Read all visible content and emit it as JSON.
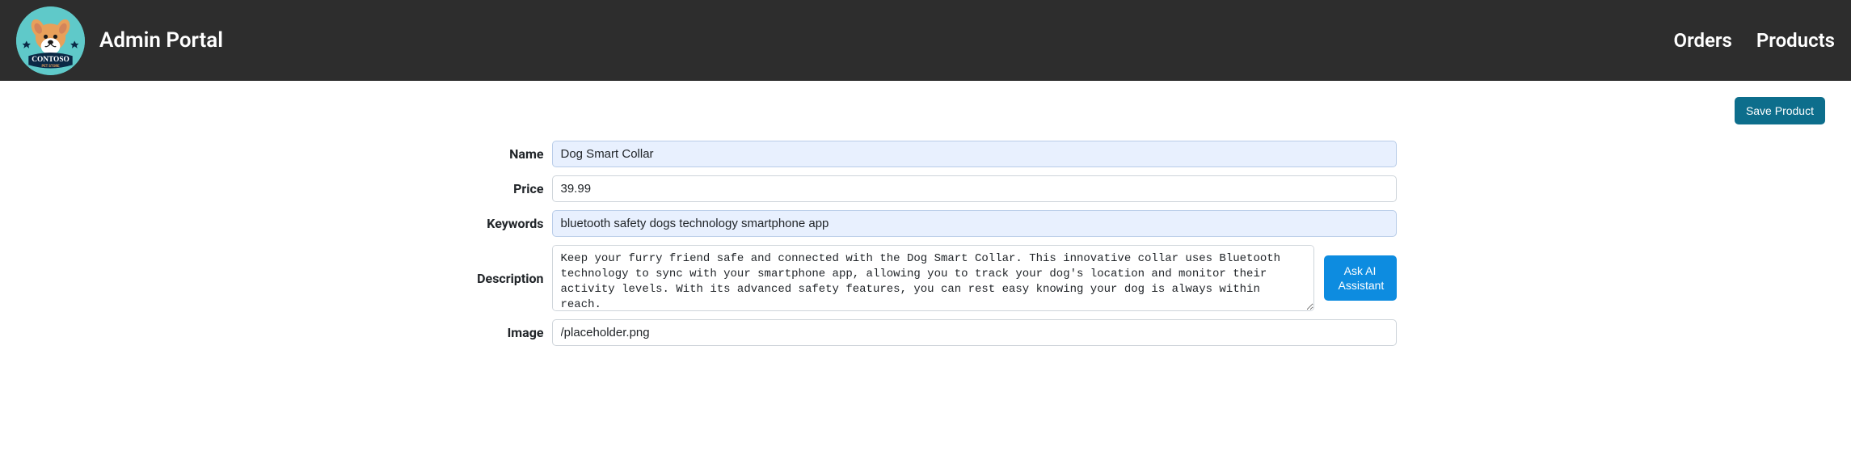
{
  "header": {
    "title": "Admin Portal",
    "nav": {
      "orders": "Orders",
      "products": "Products"
    }
  },
  "actions": {
    "save_label": "Save Product",
    "ask_ai_label": "Ask AI Assistant"
  },
  "form": {
    "name": {
      "label": "Name",
      "value": "Dog Smart Collar"
    },
    "price": {
      "label": "Price",
      "value": "39.99"
    },
    "keywords": {
      "label": "Keywords",
      "value": "bluetooth safety dogs technology smartphone app"
    },
    "description": {
      "label": "Description",
      "value": "Keep your furry friend safe and connected with the Dog Smart Collar. This innovative collar uses Bluetooth technology to sync with your smartphone app, allowing you to track your dog's location and monitor their activity levels. With its advanced safety features, you can rest easy knowing your dog is always within reach."
    },
    "image": {
      "label": "Image",
      "value": "/placeholder.png"
    }
  }
}
